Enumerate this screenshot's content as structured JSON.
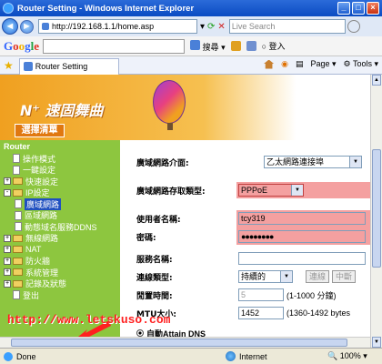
{
  "window": {
    "title": "Router Setting - Windows Internet Explorer"
  },
  "address": {
    "url": "http://192.168.1.1/home.asp",
    "search_placeholder": "Live Search"
  },
  "google": {
    "logo_g": "G",
    "logo_o1": "o",
    "logo_o2": "o",
    "logo_g2": "g",
    "logo_l": "l",
    "logo_e": "e",
    "go_label": "搜尋",
    "signin_label": "登入"
  },
  "cmdbar": {
    "tab_title": "Router Setting",
    "page_label": "Page",
    "tools_label": "Tools"
  },
  "banner": {
    "brand": "N⁺ 速固舞曲",
    "menu_label": "選擇清單"
  },
  "sidebar": {
    "root": "Router",
    "items": [
      {
        "label": "操作模式",
        "type": "doc",
        "level": 1
      },
      {
        "label": "一鍵設定",
        "type": "doc",
        "level": 1
      },
      {
        "label": "快速設定",
        "type": "folder",
        "level": 1,
        "pm": "+"
      },
      {
        "label": "IP設定",
        "type": "folder",
        "level": 1,
        "pm": "-"
      },
      {
        "label": "廣域網路",
        "type": "doc",
        "level": 2,
        "selected": true
      },
      {
        "label": "區域網路",
        "type": "doc",
        "level": 2
      },
      {
        "label": "動態域名服務DDNS",
        "type": "doc",
        "level": 2
      },
      {
        "label": "無線網路",
        "type": "folder",
        "level": 1,
        "pm": "+"
      },
      {
        "label": "NAT",
        "type": "folder",
        "level": 1,
        "pm": "+"
      },
      {
        "label": "防火牆",
        "type": "folder",
        "level": 1,
        "pm": "+"
      },
      {
        "label": "系統管理",
        "type": "folder",
        "level": 1,
        "pm": "+"
      },
      {
        "label": "記錄及狀態",
        "type": "folder",
        "level": 1,
        "pm": "+"
      },
      {
        "label": "登出",
        "type": "doc",
        "level": 1
      }
    ]
  },
  "form": {
    "wan_interface_label": "廣域網路介面:",
    "wan_interface_value": "乙太網路連接埠",
    "wan_type_label": "廣域網路存取類型:",
    "wan_type_value": "PPPoE",
    "username_label": "使用者名稱:",
    "username_value": "tcy319",
    "password_label": "密碼:",
    "password_value": "●●●●●●●●",
    "service_label": "服務名稱:",
    "service_value": "",
    "conn_type_label": "連線類型:",
    "conn_type_value": "持續的",
    "connect_btn": "連線",
    "disconnect_btn": "中斷",
    "idle_label": "閒置時間:",
    "idle_value": "5",
    "idle_hint": "(1-1000 分鐘)",
    "mtu_label": "MTU大小:",
    "mtu_value": "1452",
    "mtu_hint": "(1360-1492 bytes",
    "dns_label": "自動Attain DNS"
  },
  "watermark": "http://www.letskuso.com",
  "status": {
    "text": "Done",
    "zone": "Internet",
    "zoom": "100%"
  }
}
